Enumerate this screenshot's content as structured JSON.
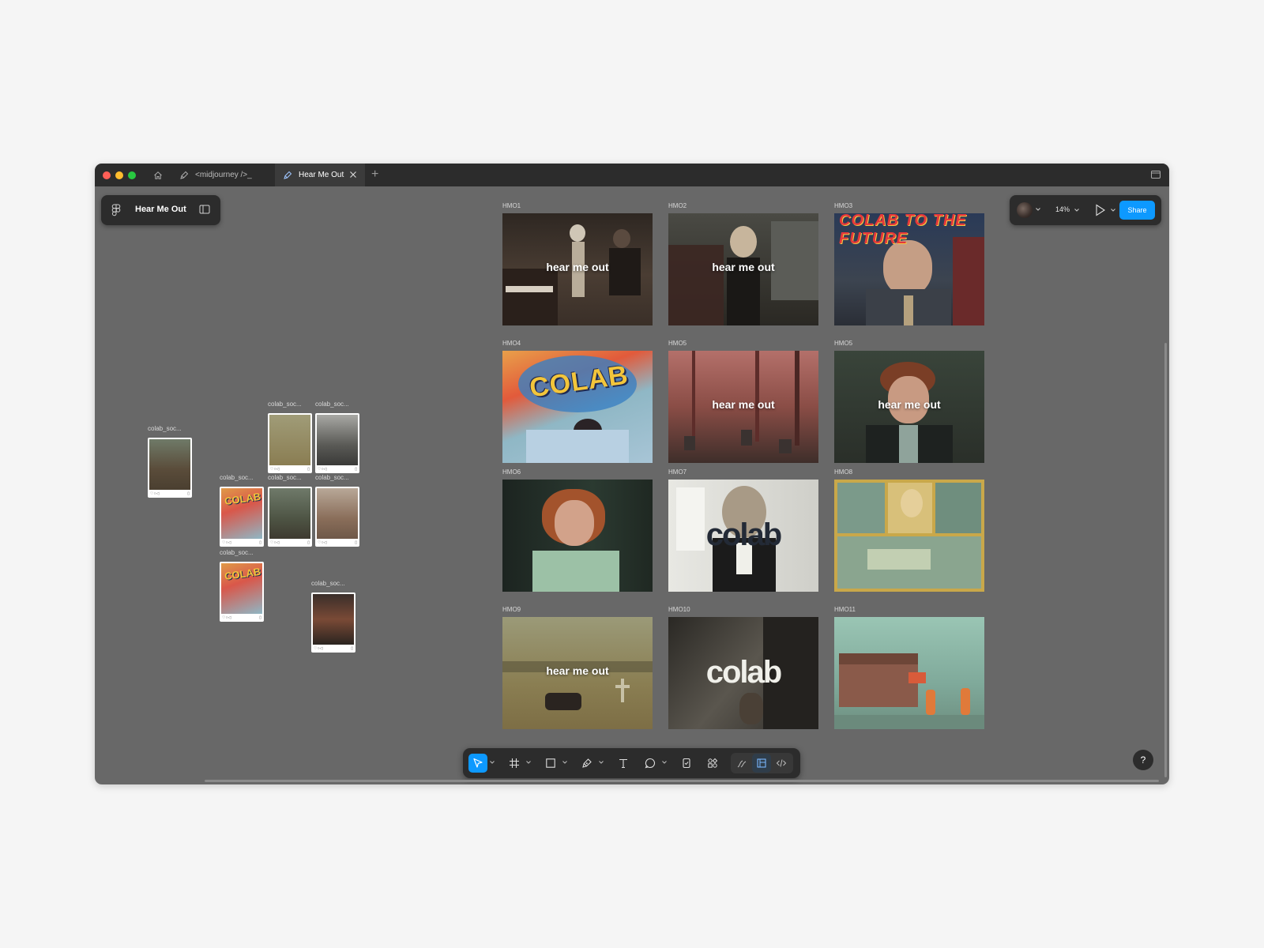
{
  "window": {
    "traffic_lights": [
      "#ff5f57",
      "#febc2e",
      "#28c840"
    ],
    "tabs": [
      {
        "label": "<midjourney />_",
        "active": false
      },
      {
        "label": "Hear Me Out",
        "active": true
      }
    ],
    "new_tab": "+"
  },
  "file_panel": {
    "file_name": "Hear Me Out"
  },
  "right_panel": {
    "zoom": "14%",
    "share_label": "Share"
  },
  "frames": [
    {
      "label": "HMO1",
      "overlay": "hear me out"
    },
    {
      "label": "HMO2",
      "overlay": "hear me out"
    },
    {
      "label": "HMO3",
      "overlay": "COLAB TO THE FUTURE"
    },
    {
      "label": "HMO4",
      "overlay": "COLAB"
    },
    {
      "label": "HMO5",
      "overlay": "hear me out"
    },
    {
      "label": "HMO5",
      "overlay": "hear me out"
    },
    {
      "label": "HMO6",
      "overlay": ""
    },
    {
      "label": "HMO7",
      "overlay": "colab"
    },
    {
      "label": "HMO8",
      "overlay": ""
    },
    {
      "label": "HMO9",
      "overlay": "hear me out"
    },
    {
      "label": "HMO10",
      "overlay": "colab"
    },
    {
      "label": "HMO11",
      "overlay": ""
    }
  ],
  "thumbnails": [
    {
      "label": "colab_soc...",
      "text": ""
    },
    {
      "label": "colab_soc...",
      "text": ""
    },
    {
      "label": "colab_soc...",
      "text": ""
    },
    {
      "label": "colab_soc...",
      "text": "COLAB"
    },
    {
      "label": "colab_soc...",
      "text": ""
    },
    {
      "label": "colab_soc...",
      "text": ""
    },
    {
      "label": "colab_soc...",
      "text": "COLAB"
    },
    {
      "label": "colab_soc...",
      "text": ""
    }
  ],
  "thumbnail_footer": {
    "dots": "♡○◁",
    "tick": "▯"
  },
  "toolbar": {
    "tools": [
      "move-tool",
      "frame-tool",
      "shape-tool",
      "pen-tool",
      "text-tool",
      "comment-tool",
      "resources-tool",
      "actions-tool",
      "draw-mode",
      "design-mode",
      "dev-mode"
    ],
    "accent": "#0d99ff"
  },
  "help": {
    "label": "?"
  }
}
